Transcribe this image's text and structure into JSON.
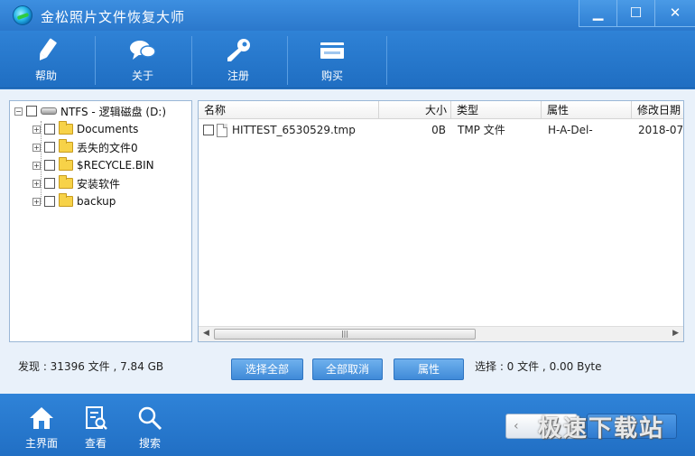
{
  "window": {
    "title": "金松照片文件恢复大师",
    "minimize": "▁",
    "maximize": "☐",
    "close": "✕"
  },
  "toolbar": {
    "items": [
      {
        "label": "帮助",
        "icon": "pencil-icon"
      },
      {
        "label": "关于",
        "icon": "chat-bubbles-icon"
      },
      {
        "label": "注册",
        "icon": "key-icon"
      },
      {
        "label": "购买",
        "icon": "card-icon"
      }
    ]
  },
  "tree": {
    "root": {
      "label": "NTFS - 逻辑磁盘 (D:)",
      "icon": "drive-icon"
    },
    "children": [
      {
        "label": "Documents"
      },
      {
        "label": "丢失的文件0"
      },
      {
        "label": "$RECYCLE.BIN"
      },
      {
        "label": "安装软件"
      },
      {
        "label": "backup"
      }
    ]
  },
  "file_list": {
    "columns": [
      "名称",
      "大小",
      "类型",
      "属性",
      "修改日期"
    ],
    "rows": [
      {
        "name": "HITTEST_6530529.tmp",
        "size": "0B",
        "type": "TMP 文件",
        "attr": "H-A-Del-",
        "date": "2018-07-"
      }
    ],
    "scroll_grip": "|||"
  },
  "status": {
    "found": "发现 : 31396 文件 , 7.84 GB",
    "selected": "选择 : 0 文件 , 0.00 Byte"
  },
  "actions": {
    "select_all": "选择全部",
    "deselect_all": "全部取消",
    "properties": "属性"
  },
  "bottom_nav": [
    {
      "label": "主界面",
      "icon": "home-icon"
    },
    {
      "label": "查看",
      "icon": "document-search-icon"
    },
    {
      "label": "搜索",
      "icon": "magnifier-icon"
    }
  ],
  "back_arrow": "‹",
  "watermark": "极速下载站"
}
